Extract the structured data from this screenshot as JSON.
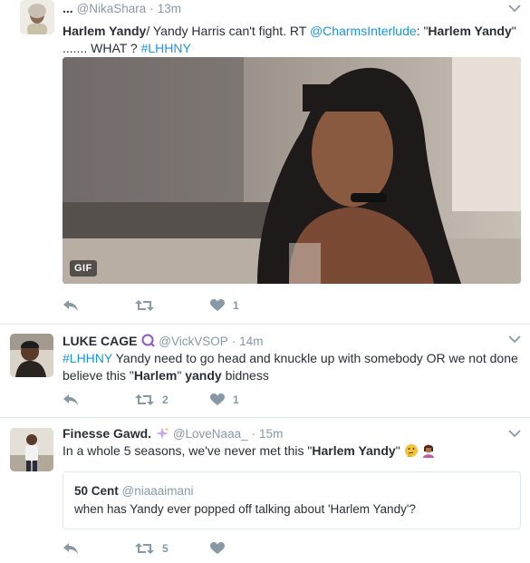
{
  "tweets": [
    {
      "fullname": "...",
      "handle": "@NikaShara",
      "dot": "·",
      "time": "13m",
      "text": {
        "bold1": "Harlem Yandy",
        "part1": "/ Yandy Harris can't fight.  RT ",
        "mention": "@CharmsInterlude",
        "part2": ": \"",
        "bold2": "Harlem Yandy",
        "part3": "\" ....... WHAT ? ",
        "hashtag": "#LHHNY"
      },
      "media": {
        "badge": "GIF"
      },
      "actions": {
        "retweets": "",
        "likes": "1"
      }
    },
    {
      "fullname": "LUKE CAGE",
      "handle": "@VickVSOP",
      "dot": "·",
      "time": "14m",
      "text": {
        "hashtag": "#LHHNY",
        "part1": " Yandy need to go head and knuckle up with somebody OR we not done believe this \"",
        "bold1": "Harlem",
        "part2": "\" ",
        "bold2": "yandy",
        "part3": " bidness"
      },
      "actions": {
        "retweets": "2",
        "likes": "1"
      }
    },
    {
      "fullname": "Finesse Gawd.",
      "handle": "@LoveNaaa_",
      "dot": "·",
      "time": "15m",
      "text": {
        "part1": "In a whole 5 seasons, we've never met this \"",
        "bold1": "Harlem Yandy",
        "part2": "\""
      },
      "quote": {
        "fullname": "50 Cent",
        "handle": "@niaaaimani",
        "text": "when has Yandy ever popped off talking about 'Harlem Yandy'?"
      },
      "actions": {
        "retweets": "5",
        "likes": ""
      }
    }
  ],
  "colors": {
    "link": "#1b95e0",
    "muted": "#8899a6",
    "border": "#e1e8ed",
    "text": "#292f33"
  }
}
